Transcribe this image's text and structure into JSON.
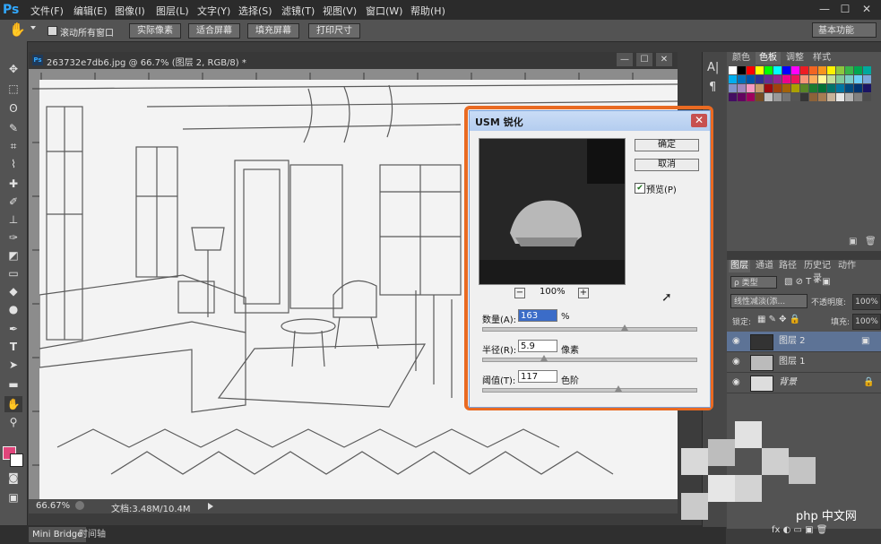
{
  "app": {
    "logo": "Ps"
  },
  "menu": [
    "文件(F)",
    "编辑(E)",
    "图像(I)",
    "图层(L)",
    "文字(Y)",
    "选择(S)",
    "滤镜(T)",
    "视图(V)",
    "窗口(W)",
    "帮助(H)"
  ],
  "window_controls": {
    "minimize": "—",
    "maximize": "☐",
    "close": "✕"
  },
  "options": {
    "scroll_all_label": "滚动所有窗口",
    "buttons": [
      "实际像素",
      "适合屏幕",
      "填充屏幕",
      "打印尺寸"
    ],
    "workspace": "基本功能"
  },
  "document": {
    "tab_title": "263732e7db6.jpg @ 66.7% (图层 2, RGB/8) *",
    "zoom": "66.67%",
    "doc_size": "文档:3.48M/10.4M"
  },
  "bottom_tabs": [
    "Mini Bridge",
    "时间轴"
  ],
  "swatch_tabs": [
    "颜色",
    "色板",
    "调整",
    "样式"
  ],
  "swatch_colors": [
    "#ffffff",
    "#000000",
    "#ff0000",
    "#ffff00",
    "#00ff00",
    "#00ffff",
    "#0000ff",
    "#ff00ff",
    "#ed1c24",
    "#f26522",
    "#f7941d",
    "#fff200",
    "#8dc63f",
    "#39b54a",
    "#00a651",
    "#00a99d",
    "#00aeef",
    "#0072bc",
    "#0054a6",
    "#2e3192",
    "#662d91",
    "#92278f",
    "#ec008c",
    "#ed145b",
    "#f69679",
    "#fbaf5d",
    "#fff799",
    "#c4df9b",
    "#82ca9c",
    "#7accc8",
    "#6dcff6",
    "#7da7d9",
    "#8393ca",
    "#a187be",
    "#f49ac2",
    "#c69c6d",
    "#9e0b0f",
    "#a0410d",
    "#a36209",
    "#aba000",
    "#598527",
    "#1a7b30",
    "#007236",
    "#00746b",
    "#0076a3",
    "#004b80",
    "#003471",
    "#1b1464",
    "#440e62",
    "#630460",
    "#9e005d",
    "#754c24",
    "#c2c2c2",
    "#999999",
    "#737373",
    "#555555",
    "#363636",
    "#8c6239",
    "#a67c52",
    "#c7b299",
    "#e6e6e6",
    "#b3b3b3",
    "#808080",
    "#4d4d4d"
  ],
  "layers_tabs": [
    "图层",
    "通道",
    "路径",
    "历史记录",
    "动作"
  ],
  "layers": {
    "filter_label": "ρ 类型",
    "blend_mode": "线性减淡(添...",
    "opacity_label": "不透明度:",
    "opacity": "100%",
    "lock_label": "锁定:",
    "fill_label": "填充:",
    "fill": "100%",
    "items": [
      {
        "name": "图层 2",
        "selected": true
      },
      {
        "name": "图层 1",
        "selected": false
      },
      {
        "name": "背景",
        "selected": false
      }
    ]
  },
  "dialog": {
    "title": "USM 锐化",
    "ok": "确定",
    "cancel": "取消",
    "preview_label": "预览(P)",
    "preview_checked": true,
    "preview_zoom": "100%",
    "zoom_out": "−",
    "zoom_in": "+",
    "amount": {
      "label": "数量(A):",
      "value": "163",
      "unit": "%",
      "fraction": 0.67
    },
    "radius": {
      "label": "半径(R):",
      "value": "5.9",
      "unit": "像素",
      "fraction": 0.29
    },
    "threshold": {
      "label": "阈值(T):",
      "value": "117",
      "unit": "色阶",
      "fraction": 0.64
    }
  },
  "watermark": "php 中文网"
}
